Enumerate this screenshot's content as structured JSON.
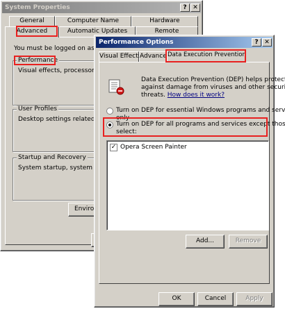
{
  "sys": {
    "title": "System Properties",
    "tabs_row1": [
      "General",
      "Computer Name",
      "Hardware"
    ],
    "tabs_row2": [
      "Advanced",
      "Automatic Updates",
      "Remote"
    ],
    "intro": "You must be logged on as an A",
    "performance": {
      "label": "Performance",
      "text": "Visual effects, processor sche"
    },
    "profiles": {
      "label": "User Profiles",
      "text": "Desktop settings related to yo"
    },
    "startup": {
      "label": "Startup and Recovery",
      "text": "System startup, system failure,"
    },
    "env_button": "Environ"
  },
  "perf": {
    "title": "Performance Options",
    "tabs": [
      "Visual Effects",
      "Advanced",
      "Data Execution Prevention"
    ],
    "desc_lines": [
      "Data Execution Prevention (DEP) helps protect",
      "against damage from viruses and other security"
    ],
    "desc_line3": "threats.",
    "how_link": "How does it work?",
    "option1_lines": [
      "Turn on DEP for essential Windows programs and services",
      "only"
    ],
    "option2_lines": [
      "Turn on DEP for all programs and services except those I",
      "select:"
    ],
    "list_items": [
      "Opera Screen Painter"
    ],
    "add_button": "Add...",
    "remove_button": "Remove",
    "ok_button": "OK",
    "cancel_button": "Cancel",
    "apply_button": "Apply"
  },
  "colors": {
    "highlight": "#e8201f",
    "active_title": "#0a246a",
    "face": "#d4d0c8"
  }
}
